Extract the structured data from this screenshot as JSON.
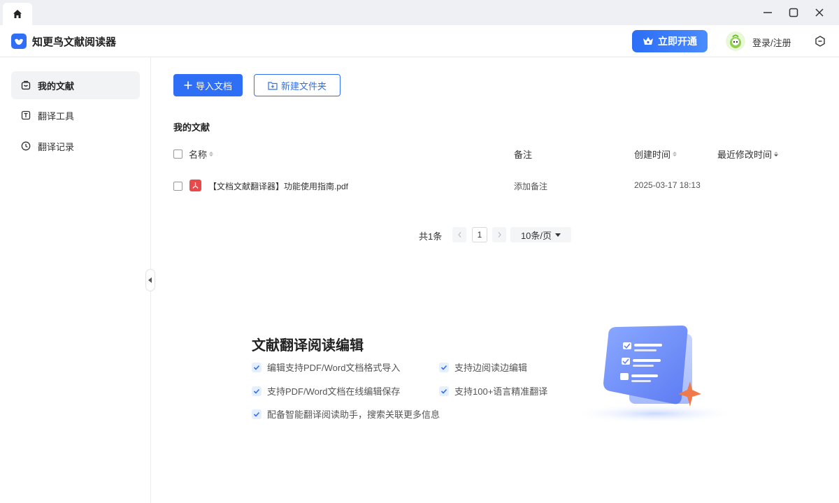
{
  "titlebar": {
    "home_icon": "home-icon",
    "controls": [
      "minimize-icon",
      "maximize-icon",
      "close-icon"
    ]
  },
  "header": {
    "app_title": "知更鸟文献阅读器",
    "vip_label": "立即开通",
    "login_label": "登录/注册",
    "accent": "#2f6ff5"
  },
  "sidebar": {
    "items": [
      {
        "label": "我的文献",
        "icon": "library-icon",
        "active": true
      },
      {
        "label": "翻译工具",
        "icon": "translate-tool-icon",
        "active": false
      },
      {
        "label": "翻译记录",
        "icon": "clock-icon",
        "active": false
      }
    ]
  },
  "toolbar": {
    "import_label": "导入文档",
    "new_folder_label": "新建文件夹"
  },
  "section_title": "我的文献",
  "table": {
    "columns": [
      "名称",
      "备注",
      "创建时间",
      "最近修改时间"
    ],
    "rows": [
      {
        "name": "【文档文献翻译器】功能使用指南.pdf",
        "note": "添加备注",
        "created": "2025-03-17 18:13",
        "modified": "",
        "icon": "pdf-icon"
      }
    ]
  },
  "pagination": {
    "total": "共1条",
    "current_page": "1",
    "page_size": "10条/页"
  },
  "promo": {
    "title": "文献翻译阅读编辑",
    "features": [
      "编辑支持PDF/Word文档格式导入",
      "支持边阅读边编辑",
      "支持PDF/Word文档在线编辑保存",
      "支持100+语言精准翻译",
      "配备智能翻译阅读助手，搜索关联更多信息"
    ]
  }
}
